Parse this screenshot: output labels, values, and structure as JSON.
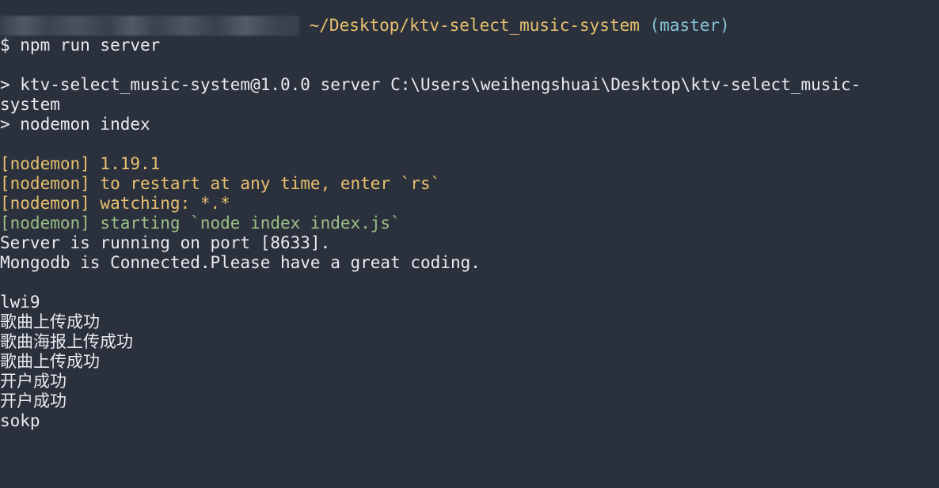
{
  "terminal": {
    "prompt": {
      "path": " ~/Desktop/ktv-select_music-system",
      "branch": " (master)"
    },
    "command": "$ npm run server",
    "script_lines": [
      "> ktv-select_music-system@1.0.0 server C:\\Users\\weihengshuai\\Desktop\\ktv-select_music-",
      "system",
      "> nodemon index"
    ],
    "nodemon_lines": [
      "[nodemon] 1.19.1",
      "[nodemon] to restart at any time, enter `rs`",
      "[nodemon] watching: *.*"
    ],
    "nodemon_starting": "[nodemon] starting `node index index.js`",
    "server_lines": [
      "Server is running on port [8633].",
      "Mongodb is Connected.Please have a great coding."
    ],
    "output_lines": [
      "lwi9",
      "歌曲上传成功",
      "歌曲海报上传成功",
      "歌曲上传成功",
      "开户成功",
      "开户成功",
      "sokp"
    ]
  },
  "colors": {
    "background": "#2b313c",
    "text": "#e8eaee",
    "path": "#e8c06f",
    "branch": "#86c5d6",
    "nodemon_info": "#e8c06f",
    "nodemon_starting": "#9bbf86"
  }
}
